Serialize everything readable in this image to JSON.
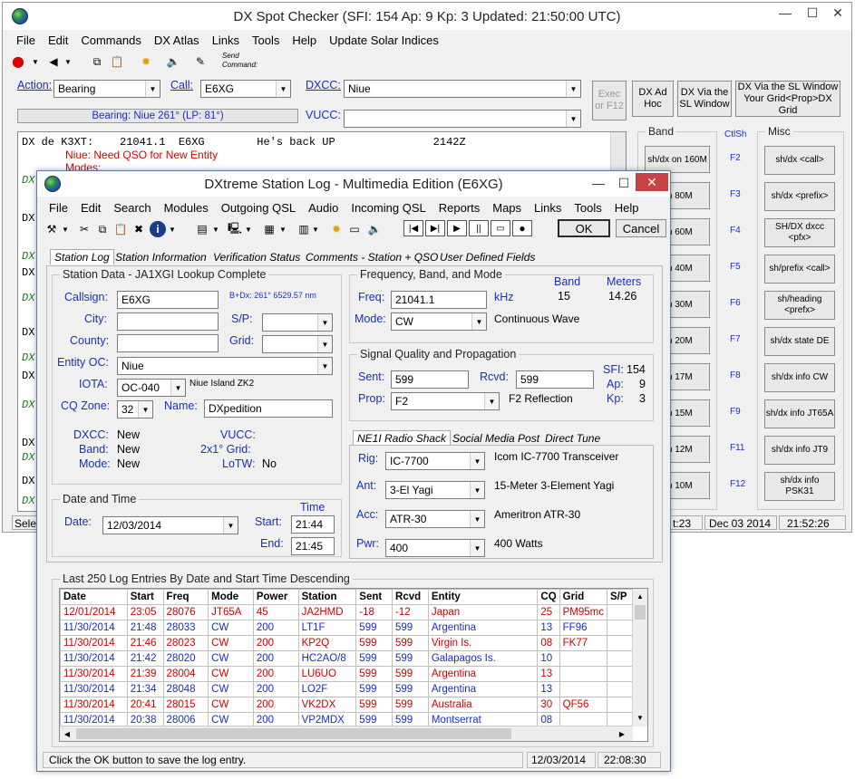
{
  "bg_window": {
    "title": "DX Spot Checker (SFI: 154 Ap: 9 Kp: 3 Updated: 21:50:00 UTC)",
    "menu": [
      "File",
      "Edit",
      "Commands",
      "DX Atlas",
      "Links",
      "Tools",
      "Help",
      "Update Solar Indices"
    ],
    "send_command_label": "Send Command:",
    "action_label": "Action:",
    "action_value": "Bearing",
    "call_label": "Call:",
    "call_value": "E6XG",
    "dxcc_label": "DXCC:",
    "dxcc_value": "Niue",
    "vucc_label": "VUCC:",
    "bearing_text": "Bearing: Niue 261° (LP: 81°)",
    "exec_button": "Exec or F12",
    "dx_ad_hoc": "DX Ad Hoc",
    "dx_via_sl": "DX Via the SL Window",
    "dx_via_sl_grid": "DX Via the SL Window Your Grid<Prop>DX Grid",
    "spot_line": "DX de K3XT:    21041.1  E6XG        He's back UP               2142Z",
    "spot_note1": "Niue: Need QSO for New Entity",
    "spot_note2": "Modes:",
    "dx_rows": [
      "DX",
      "DX",
      "DX",
      "DX",
      "DX",
      "DX",
      "DX",
      "DX",
      "DX",
      "DX",
      "DX",
      "DX",
      "DX"
    ],
    "band_caption": "Band",
    "ctlsh_caption": "CtlSh",
    "misc_caption": "Misc",
    "band_buttons": [
      "sh/dx on 160M",
      "on 80M",
      "on 60M",
      "on 40M",
      "on 30M",
      "on 20M",
      "on 17M",
      "on 15M",
      "on 12M",
      "on 10M"
    ],
    "fkeys": [
      "F2",
      "F3",
      "F4",
      "F5",
      "F6",
      "F7",
      "F8",
      "F9",
      "F11",
      "F12"
    ],
    "misc_buttons": [
      "sh/dx <call>",
      "sh/dx <prefix>",
      "SH/DX dxcc <pfx>",
      "sh/prefix <call>",
      "sh/heading <prefx>",
      "sh/dx state DE",
      "sh/dx info CW",
      "sh/dx info JT65A",
      "sh/dx info JT9",
      "sh/dx info PSK31"
    ],
    "status_left": "Sele",
    "status_time1": "t:23",
    "status_date": "Dec 03 2014",
    "status_time2": "21:52:26"
  },
  "log_window": {
    "title": "DXtreme Station Log - Multimedia Edition (E6XG)",
    "menu": [
      "File",
      "Edit",
      "Search",
      "Modules",
      "Outgoing QSL",
      "Audio",
      "Incoming QSL",
      "Reports",
      "Maps",
      "Links",
      "Tools",
      "Help"
    ],
    "ok_label": "OK",
    "cancel_label": "Cancel",
    "tabs": [
      "Station Log",
      "Station Information",
      "Verification Status",
      "Comments - Station + QSO",
      "User Defined Fields"
    ],
    "station_data": {
      "caption": "Station Data - JA1XGI Lookup Complete",
      "callsign_label": "Callsign:",
      "callsign": "E6XG",
      "bearing": "B+Dx: 261° 6529.57 nm",
      "city_label": "City:",
      "sp_label": "S/P:",
      "county_label": "County:",
      "grid_label": "Grid:",
      "entity_label": "Entity OC:",
      "entity": "Niue",
      "iota_label": "IOTA:",
      "iota": "OC-040",
      "iota_name": "Niue Island ZK2",
      "cq_label": "CQ Zone:",
      "cq": "32",
      "name_label": "Name:",
      "name": "DXpedition",
      "dxcc_label": "DXCC:",
      "dxcc": "New",
      "vucc_label": "VUCC:",
      "band_label": "Band:",
      "band": "New",
      "grid2_label": "2x1° Grid:",
      "mode_label": "Mode:",
      "mode": "New",
      "lotw_label": "LoTW:",
      "lotw": "No"
    },
    "date_time": {
      "caption": "Date and Time",
      "time_header": "Time",
      "date_label": "Date:",
      "date": "12/03/2014",
      "start_label": "Start:",
      "start": "21:44",
      "end_label": "End:",
      "end": "21:45"
    },
    "freq": {
      "caption": "Frequency, Band, and Mode",
      "band_header": "Band",
      "meters_header": "Meters",
      "freq_label": "Freq:",
      "freq": "21041.1",
      "unit": "kHz",
      "band": "15",
      "meters": "14.26",
      "mode_label": "Mode:",
      "mode": "CW",
      "mode_desc": "Continuous Wave"
    },
    "signal": {
      "caption": "Signal Quality and Propagation",
      "sent_label": "Sent:",
      "sent": "599",
      "rcvd_label": "Rcvd:",
      "rcvd": "599",
      "sfi_label": "SFI:",
      "sfi": "154",
      "ap_label": "Ap:",
      "ap": "9",
      "kp_label": "Kp:",
      "kp": "3",
      "prop_label": "Prop:",
      "prop": "F2",
      "prop_desc": "F2 Reflection"
    },
    "rig_tabs": [
      "NE1I Radio Shack",
      "Social Media Post",
      "Direct Tune"
    ],
    "rig": {
      "rig_label": "Rig:",
      "rig": "IC-7700",
      "rig_desc": "Icom IC-7700 Transceiver",
      "ant_label": "Ant:",
      "ant": "3-El Yagi",
      "ant_desc": "15-Meter 3-Element Yagi",
      "acc_label": "Acc:",
      "acc": "ATR-30",
      "acc_desc": "Ameritron ATR-30",
      "pwr_label": "Pwr:",
      "pwr": "400",
      "pwr_desc": "400 Watts"
    },
    "entries_caption": "Last 250 Log Entries By Date and Start Time Descending",
    "columns": [
      "Date",
      "Start",
      "Freq",
      "Mode",
      "Power",
      "Station",
      "Sent",
      "Rcvd",
      "Entity",
      "CQ",
      "Grid",
      "S/P"
    ],
    "rows": [
      {
        "c": [
          "12/01/2014",
          "23:05",
          "28076",
          "JT65A",
          "45",
          "JA2HMD",
          "-18",
          "-12",
          "Japan",
          "25",
          "PM95mc",
          ""
        ],
        "color": "#d00000"
      },
      {
        "c": [
          "11/30/2014",
          "21:48",
          "28033",
          "CW",
          "200",
          "LT1F",
          "599",
          "599",
          "Argentina",
          "13",
          "FF96",
          ""
        ],
        "color": "#1a2fbf"
      },
      {
        "c": [
          "11/30/2014",
          "21:46",
          "28023",
          "CW",
          "200",
          "KP2Q",
          "599",
          "599",
          "Virgin Is.",
          "08",
          "FK77",
          ""
        ],
        "color": "#d00000"
      },
      {
        "c": [
          "11/30/2014",
          "21:42",
          "28020",
          "CW",
          "200",
          "HC2AO/8",
          "599",
          "599",
          "Galapagos Is.",
          "10",
          "",
          ""
        ],
        "color": "#1a2fbf"
      },
      {
        "c": [
          "11/30/2014",
          "21:39",
          "28004",
          "CW",
          "200",
          "LU6UO",
          "599",
          "599",
          "Argentina",
          "13",
          "",
          ""
        ],
        "color": "#d00000"
      },
      {
        "c": [
          "11/30/2014",
          "21:34",
          "28048",
          "CW",
          "200",
          "LO2F",
          "599",
          "599",
          "Argentina",
          "13",
          "",
          ""
        ],
        "color": "#1a2fbf"
      },
      {
        "c": [
          "11/30/2014",
          "20:41",
          "28015",
          "CW",
          "200",
          "VK2DX",
          "599",
          "599",
          "Australia",
          "30",
          "QF56",
          ""
        ],
        "color": "#d00000"
      },
      {
        "c": [
          "11/30/2014",
          "20:38",
          "28006",
          "CW",
          "200",
          "VP2MDX",
          "599",
          "599",
          "Montserrat",
          "08",
          "",
          ""
        ],
        "color": "#1a2fbf"
      }
    ],
    "status_text": "Click the OK button to save the log entry.",
    "status_date": "12/03/2014",
    "status_time": "22:08:30"
  }
}
